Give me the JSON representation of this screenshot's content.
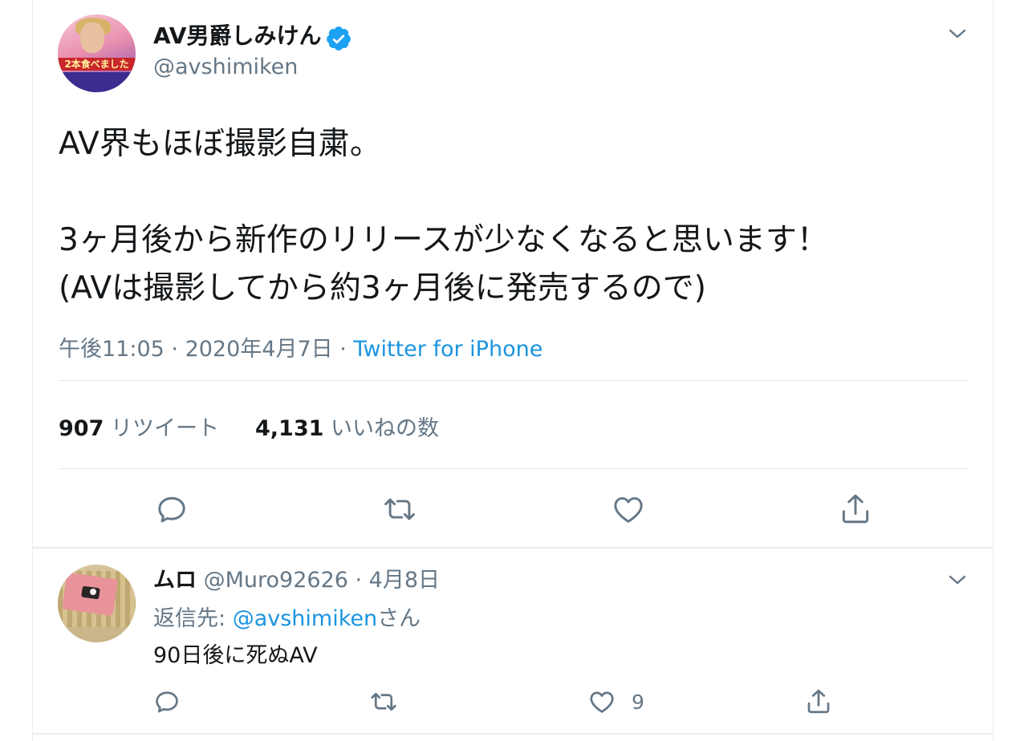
{
  "main_tweet": {
    "display_name": "AV男爵しみけん",
    "handle": "@avshimiken",
    "avatar_caption": "2本食べました",
    "text_lines": [
      "AV界もほぼ撮影自粛。",
      "",
      "3ヶ月後から新作のリリースが少なくなると思います！",
      "(AVは撮影してから約3ヶ月後に発売するので)"
    ],
    "time": "午後11:05",
    "date": "2020年4月7日",
    "meta_sep": " · ",
    "source": "Twitter for iPhone",
    "retweet_count": "907",
    "retweet_label": "リツイート",
    "like_count": "4,131",
    "like_label": "いいねの数"
  },
  "reply": {
    "display_name": "ムロ",
    "handle": "@Muro92626",
    "date_sep": " · ",
    "date": "4月8日",
    "reply_prefix": "返信先: ",
    "reply_mention": "@avshimiken",
    "reply_suffix": "さん",
    "text": "90日後に死ぬAV",
    "like_count": "9"
  },
  "icons": {
    "verified": "verified-badge-icon",
    "menu": "chevron-down-icon",
    "reply": "reply-bubble-icon",
    "retweet": "retweet-icon",
    "like": "heart-icon",
    "share": "share-icon"
  },
  "colors": {
    "accent_blue": "#1b95e0",
    "verified_blue": "#1da1f2",
    "secondary_text": "#657786",
    "primary_text": "#14171a",
    "divider": "#e6ecf0"
  }
}
